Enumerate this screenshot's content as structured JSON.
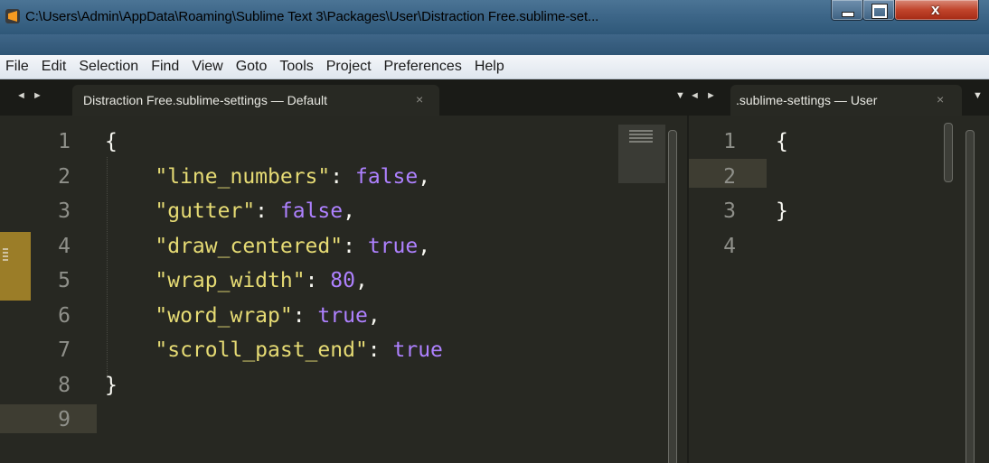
{
  "window": {
    "title": "C:\\Users\\Admin\\AppData\\Roaming\\Sublime Text 3\\Packages\\User\\Distraction Free.sublime-set...",
    "controls": {
      "minimize": "minimize",
      "maximize": "maximize",
      "close": "x"
    }
  },
  "menu": {
    "items": [
      "File",
      "Edit",
      "Selection",
      "Find",
      "View",
      "Goto",
      "Tools",
      "Project",
      "Preferences",
      "Help"
    ]
  },
  "tabs": {
    "left": {
      "nav": "◄ ►",
      "label": "Distraction Free.sublime-settings — Default",
      "close": "×",
      "menu": "▼"
    },
    "right": {
      "nav": "◄ ►",
      "label": ".sublime-settings — User",
      "close": "×",
      "menu": "▼"
    }
  },
  "editor_left": {
    "line_numbers": [
      "1",
      "2",
      "3",
      "4",
      "5",
      "6",
      "7",
      "8",
      "9"
    ],
    "lines": [
      [
        {
          "t": "{",
          "c": "tok-key"
        }
      ],
      [
        {
          "t": "    ",
          "c": "tok-key"
        },
        {
          "t": "\"line_numbers\"",
          "c": "tok-str"
        },
        {
          "t": ": ",
          "c": "tok-key"
        },
        {
          "t": "false",
          "c": "tok-const"
        },
        {
          "t": ",",
          "c": "tok-key"
        }
      ],
      [
        {
          "t": "    ",
          "c": "tok-key"
        },
        {
          "t": "\"gutter\"",
          "c": "tok-str"
        },
        {
          "t": ": ",
          "c": "tok-key"
        },
        {
          "t": "false",
          "c": "tok-const"
        },
        {
          "t": ",",
          "c": "tok-key"
        }
      ],
      [
        {
          "t": "    ",
          "c": "tok-key"
        },
        {
          "t": "\"draw_centered\"",
          "c": "tok-str"
        },
        {
          "t": ": ",
          "c": "tok-key"
        },
        {
          "t": "true",
          "c": "tok-const"
        },
        {
          "t": ",",
          "c": "tok-key"
        }
      ],
      [
        {
          "t": "    ",
          "c": "tok-key"
        },
        {
          "t": "\"wrap_width\"",
          "c": "tok-str"
        },
        {
          "t": ": ",
          "c": "tok-key"
        },
        {
          "t": "80",
          "c": "tok-const"
        },
        {
          "t": ",",
          "c": "tok-key"
        }
      ],
      [
        {
          "t": "    ",
          "c": "tok-key"
        },
        {
          "t": "\"word_wrap\"",
          "c": "tok-str"
        },
        {
          "t": ": ",
          "c": "tok-key"
        },
        {
          "t": "true",
          "c": "tok-const"
        },
        {
          "t": ",",
          "c": "tok-key"
        }
      ],
      [
        {
          "t": "    ",
          "c": "tok-key"
        },
        {
          "t": "\"scroll_past_end\"",
          "c": "tok-str"
        },
        {
          "t": ": ",
          "c": "tok-key"
        },
        {
          "t": "true",
          "c": "tok-const"
        }
      ],
      [
        {
          "t": "}",
          "c": "tok-key"
        }
      ],
      []
    ],
    "current_line": 9
  },
  "editor_right": {
    "line_numbers": [
      "1",
      "2",
      "3",
      "4"
    ],
    "lines": [
      [
        {
          "t": "{",
          "c": "tok-key"
        }
      ],
      [],
      [
        {
          "t": "}",
          "c": "tok-key"
        }
      ],
      []
    ],
    "current_line": 2
  },
  "colors": {
    "background": "#272822",
    "string": "#e6db74",
    "constant": "#ae81ff",
    "text": "#f8f8f2",
    "gutter_text": "#8f908a",
    "line_highlight": "#3e3d32"
  }
}
